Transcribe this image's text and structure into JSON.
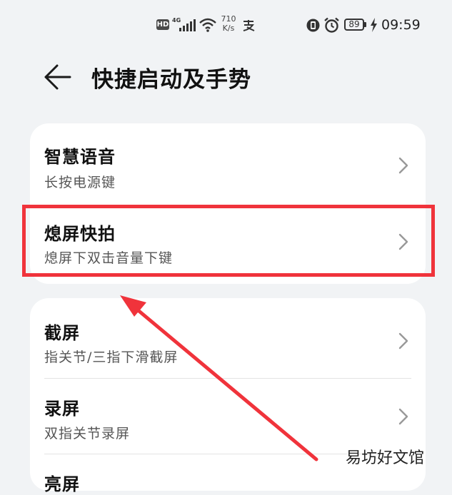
{
  "status_bar": {
    "hd_label": "HD",
    "net_type": "4G",
    "net_speed_value": "710",
    "net_speed_unit": "K/s",
    "battery_level": "89",
    "time": "09:59"
  },
  "header": {
    "title": "快捷启动及手势"
  },
  "group1": {
    "items": [
      {
        "title": "智慧语音",
        "subtitle": "长按电源键"
      },
      {
        "title": "熄屏快拍",
        "subtitle": "熄屏下双击音量下键"
      }
    ]
  },
  "group2": {
    "items": [
      {
        "title": "截屏",
        "subtitle": "指关节/三指下滑截屏"
      },
      {
        "title": "录屏",
        "subtitle": "双指关节录屏"
      },
      {
        "title": "亮屏",
        "subtitle": ""
      }
    ]
  },
  "annotation": {
    "color": "#f0333b"
  },
  "watermark": {
    "text": "易坊好文馆"
  }
}
